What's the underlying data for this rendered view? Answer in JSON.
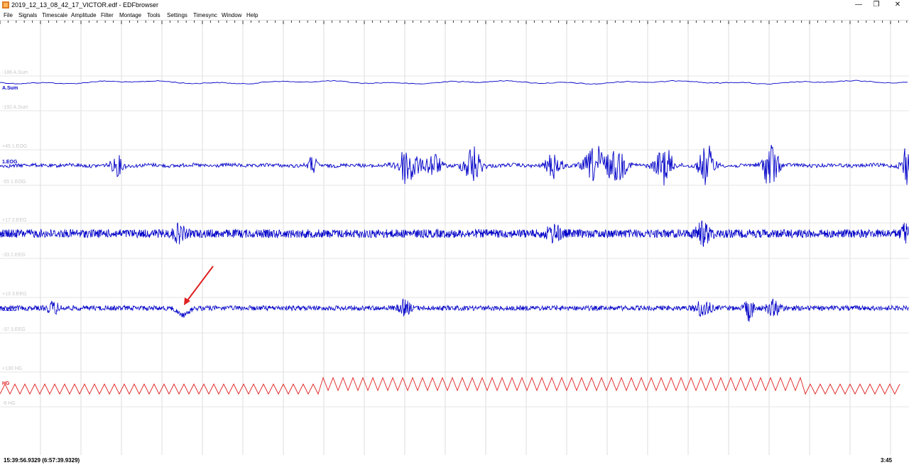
{
  "window": {
    "title": "2019_12_13_08_42_17_VICTOR.edf - EDFbrowser",
    "minimize": "—",
    "maximize": "❐",
    "close": "✕"
  },
  "menu": [
    "File",
    "Signals",
    "Timescale",
    "Amplitude",
    "Filter",
    "Montage",
    "Tools",
    "Settings",
    "Timesync",
    "Window",
    "Help"
  ],
  "signals": [
    {
      "label": "A.Sum",
      "max_label": "-186 A.Sum",
      "min_label": "-192 A.Sum",
      "color": "#0000c8"
    },
    {
      "label": "1.EOG",
      "max_label": "+45 1.EOG",
      "min_label": "-55 1.EOG",
      "color": "#0000c8"
    },
    {
      "label": "2.EEG",
      "max_label": "+17 2.EEG",
      "min_label": "-33 2.EEG",
      "color": "#0000c8"
    },
    {
      "label": "3.EEG",
      "max_label": "+13 3.EEG",
      "min_label": "-37 3.EEG",
      "color": "#0000c8"
    },
    {
      "label": "HG",
      "max_label": "+130 HG",
      "min_label": "-9 HG",
      "color": "#e02020"
    }
  ],
  "annotation": {
    "arrow_color": "#e02020"
  },
  "status": {
    "time": "15:39:56.9329 (6:57:39.9329)",
    "duration": "3:45"
  }
}
